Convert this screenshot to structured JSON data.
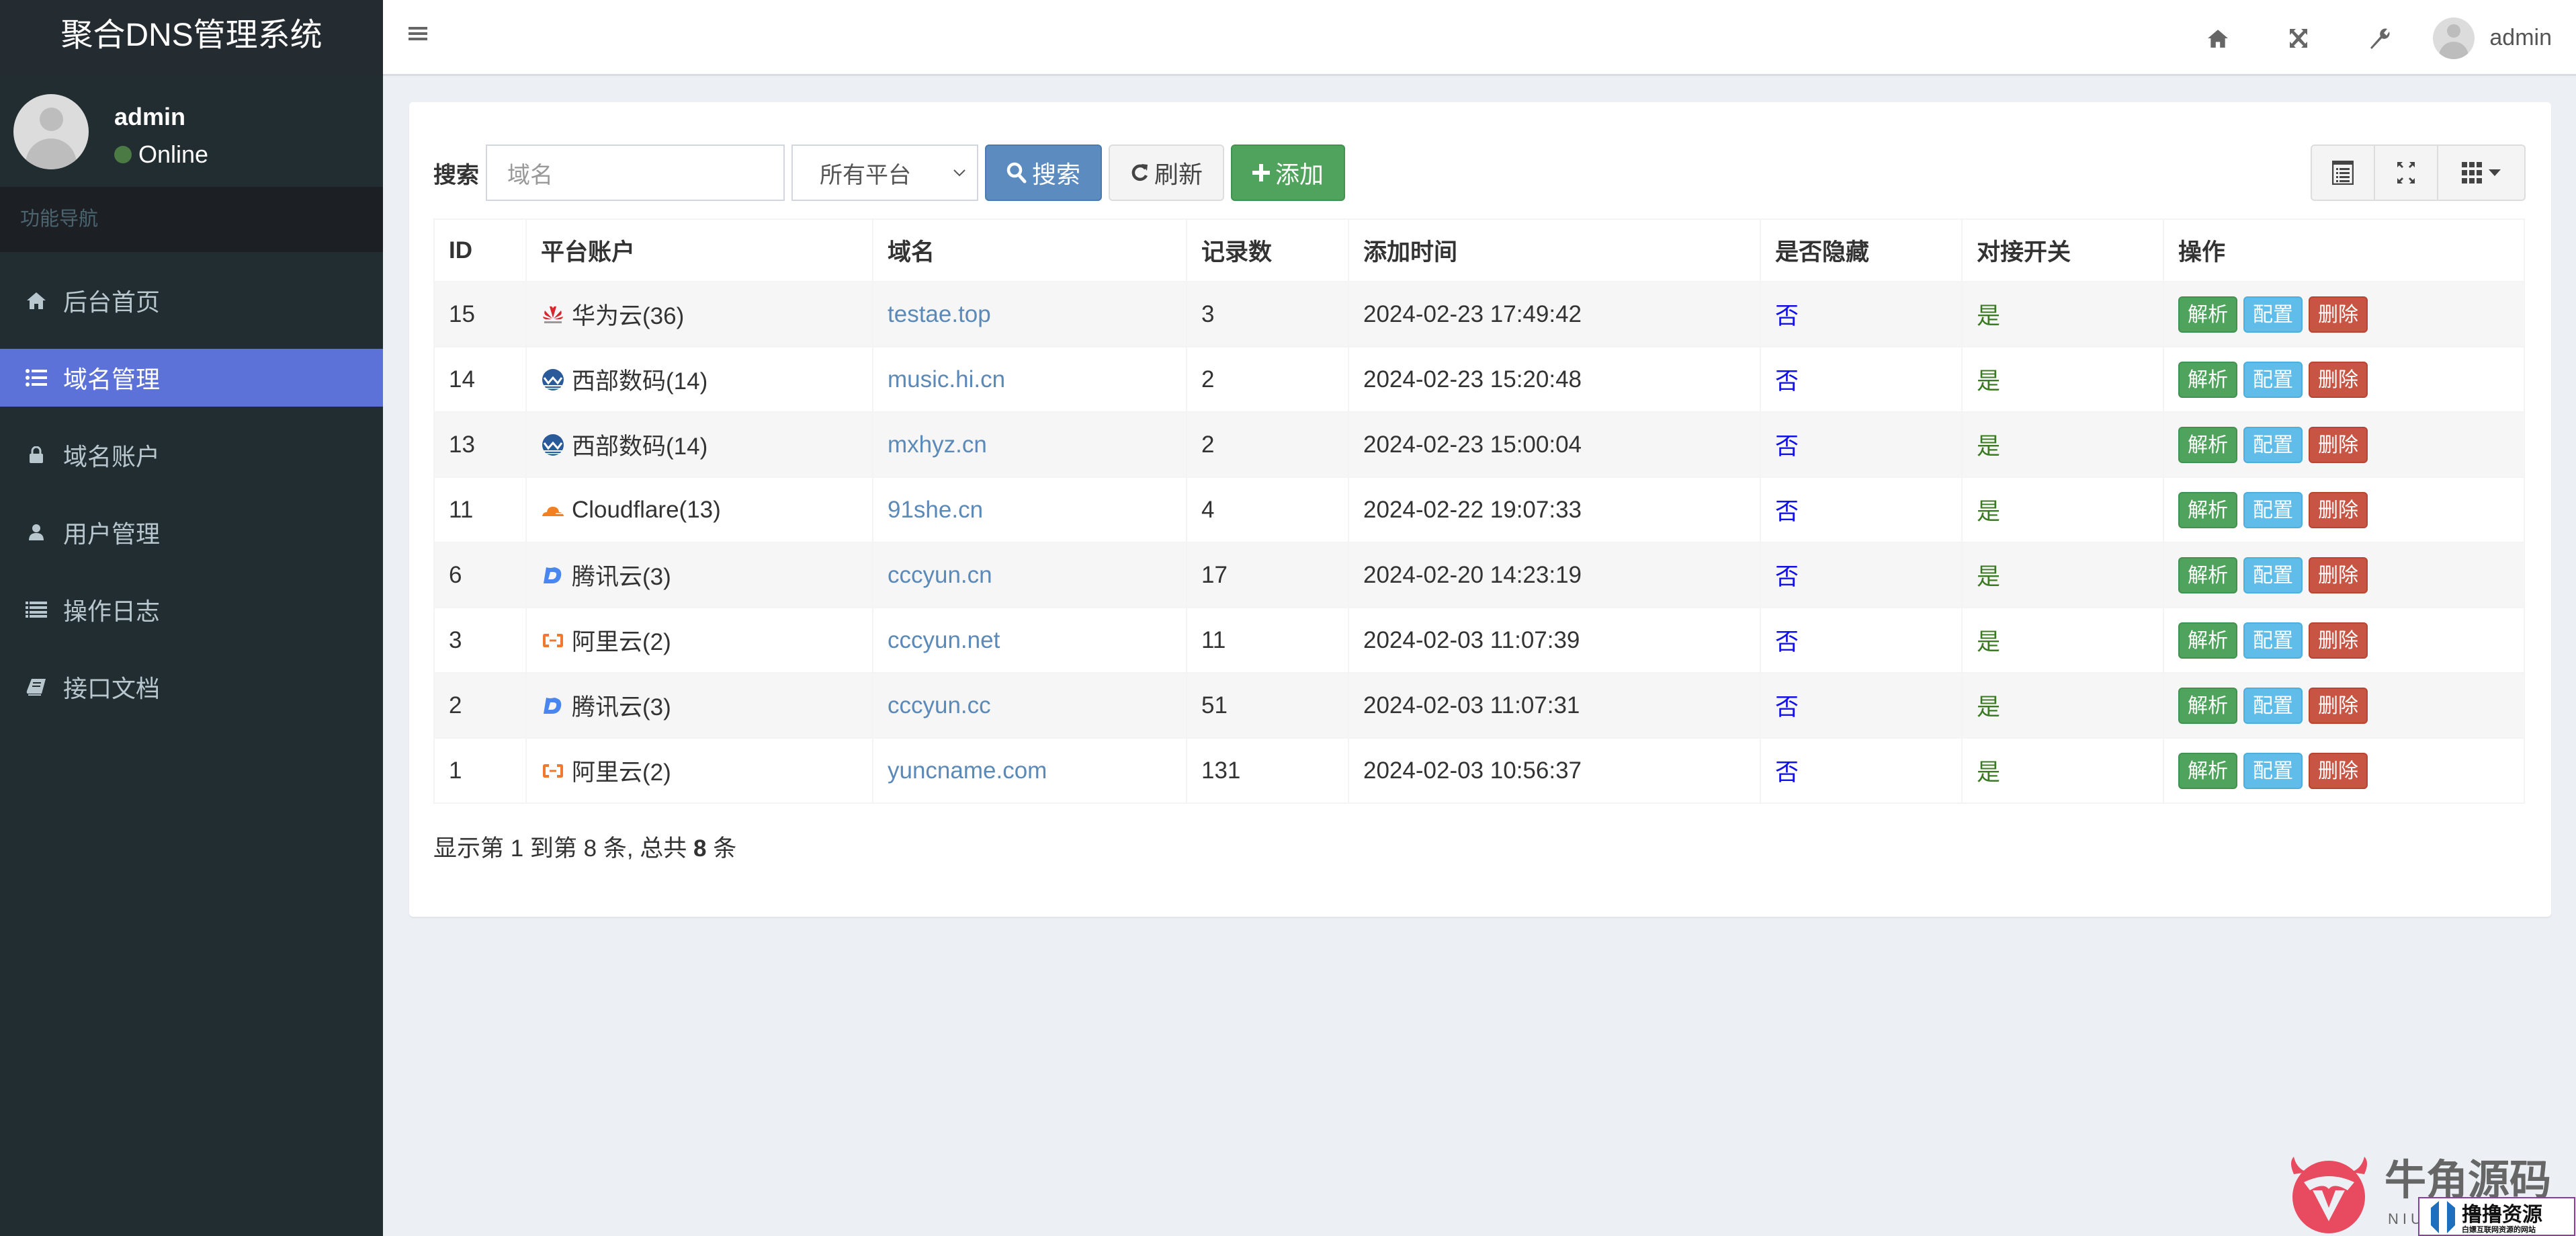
{
  "app": {
    "title": "聚合DNS管理系统"
  },
  "user": {
    "name": "admin",
    "status": "Online"
  },
  "sidebar": {
    "section_header": "功能导航",
    "items": [
      {
        "label": "后台首页",
        "icon": "home-icon",
        "active": false
      },
      {
        "label": "域名管理",
        "icon": "list-icon",
        "active": true
      },
      {
        "label": "域名账户",
        "icon": "lock-icon",
        "active": false
      },
      {
        "label": "用户管理",
        "icon": "user-icon",
        "active": false
      },
      {
        "label": "操作日志",
        "icon": "list-alt-icon",
        "active": false
      },
      {
        "label": "接口文档",
        "icon": "book-icon",
        "active": false
      }
    ]
  },
  "topbar": {
    "username": "admin",
    "icons": [
      "home-icon",
      "fullscreen-icon",
      "wrench-icon"
    ]
  },
  "toolbar": {
    "search_label": "搜索",
    "search_placeholder": "域名",
    "platform_select": "所有平台",
    "search_button": "搜索",
    "refresh_button": "刷新",
    "add_button": "添加"
  },
  "table": {
    "headers": [
      "ID",
      "平台账户",
      "域名",
      "记录数",
      "添加时间",
      "是否隐藏",
      "对接开关",
      "操作"
    ],
    "rows": [
      {
        "id": "15",
        "platform": "华为云(36)",
        "platform_icon": "huawei",
        "domain": "testae.top",
        "records": "3",
        "added": "2024-02-23 17:49:42",
        "hidden": "否",
        "enabled": "是"
      },
      {
        "id": "14",
        "platform": "西部数码(14)",
        "platform_icon": "west",
        "domain": "music.hi.cn",
        "records": "2",
        "added": "2024-02-23 15:20:48",
        "hidden": "否",
        "enabled": "是"
      },
      {
        "id": "13",
        "platform": "西部数码(14)",
        "platform_icon": "west",
        "domain": "mxhyz.cn",
        "records": "2",
        "added": "2024-02-23 15:00:04",
        "hidden": "否",
        "enabled": "是"
      },
      {
        "id": "11",
        "platform": "Cloudflare(13)",
        "platform_icon": "cloudflare",
        "domain": "91she.cn",
        "records": "4",
        "added": "2024-02-22 19:07:33",
        "hidden": "否",
        "enabled": "是"
      },
      {
        "id": "6",
        "platform": "腾讯云(3)",
        "platform_icon": "dnspod",
        "domain": "cccyun.cn",
        "records": "17",
        "added": "2024-02-20 14:23:19",
        "hidden": "否",
        "enabled": "是"
      },
      {
        "id": "3",
        "platform": "阿里云(2)",
        "platform_icon": "aliyun",
        "domain": "cccyun.net",
        "records": "11",
        "added": "2024-02-03 11:07:39",
        "hidden": "否",
        "enabled": "是"
      },
      {
        "id": "2",
        "platform": "腾讯云(3)",
        "platform_icon": "dnspod",
        "domain": "cccyun.cc",
        "records": "51",
        "added": "2024-02-03 11:07:31",
        "hidden": "否",
        "enabled": "是"
      },
      {
        "id": "1",
        "platform": "阿里云(2)",
        "platform_icon": "aliyun",
        "domain": "yuncname.com",
        "records": "131",
        "added": "2024-02-03 10:56:37",
        "hidden": "否",
        "enabled": "是"
      }
    ],
    "actions": {
      "resolve": "解析",
      "config": "配置",
      "delete": "删除"
    }
  },
  "pager": {
    "prefix": "显示第 1 到第 8 条, 总共 ",
    "total": "8",
    "suffix": " 条"
  },
  "watermark": {
    "brand": "牛角源码",
    "brand_en": "NIU",
    "overlay": "撸撸资源",
    "overlay_sub": "白嫖互联网资源的网站"
  },
  "colors": {
    "sidebar_bg": "#222d32",
    "active_nav": "#5c72d8",
    "primary": "#5b8bbf",
    "success": "#50a35c",
    "info": "#60bde9",
    "danger": "#c85443"
  }
}
